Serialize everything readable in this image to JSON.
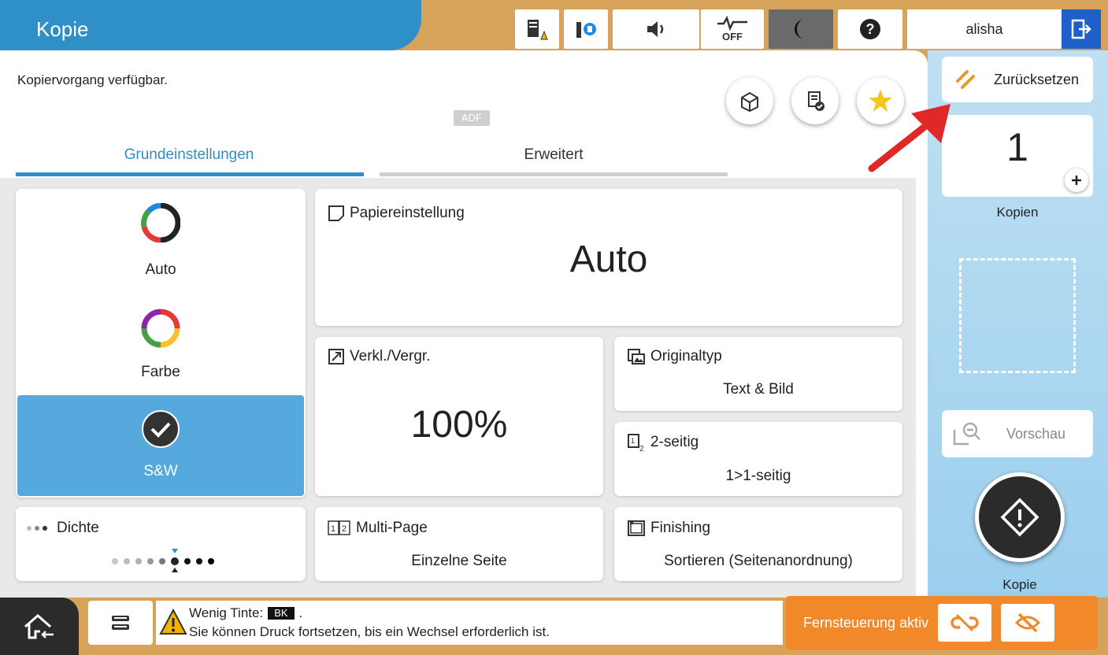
{
  "header": {
    "title": "Kopie",
    "user": "alisha"
  },
  "status": {
    "message": "Kopiervorgang verfügbar.",
    "adf_badge": "ADF"
  },
  "tabs": [
    {
      "label": "Grundeinstellungen"
    },
    {
      "label": "Erweitert"
    }
  ],
  "color_modes": [
    {
      "label": "Auto"
    },
    {
      "label": "Farbe"
    },
    {
      "label": "S&W"
    }
  ],
  "paper": {
    "title": "Papiereinstellung",
    "value": "Auto"
  },
  "zoom": {
    "title": "Verkl./Vergr.",
    "value": "100%"
  },
  "original_type": {
    "title": "Originaltyp",
    "value": "Text & Bild"
  },
  "duplex": {
    "title": "2-seitig",
    "value": "1>1-seitig"
  },
  "density": {
    "title": "Dichte",
    "level_of_9": 5
  },
  "multipage": {
    "title": "Multi-Page",
    "value": "Einzelne Seite"
  },
  "finishing": {
    "title": "Finishing",
    "value": "Sortieren (Seitenanordnung)"
  },
  "side": {
    "reset": "Zurücksetzen",
    "copies_value": "1",
    "copies_label": "Kopien",
    "preview": "Vorschau",
    "start_label": "Kopie"
  },
  "notice": {
    "line1": "Wenig Tinte:",
    "ink_badge": "BK",
    "line1_end": ".",
    "line2": "Sie können Druck fortsetzen, bis ein Wechsel erforderlich ist."
  },
  "remote": {
    "label": "Fernsteuerung aktiv"
  },
  "colors": {
    "accent": "#2f8fc7",
    "selected": "#56a9dc",
    "remote": "#f1892b",
    "arrow": "#e02828"
  }
}
